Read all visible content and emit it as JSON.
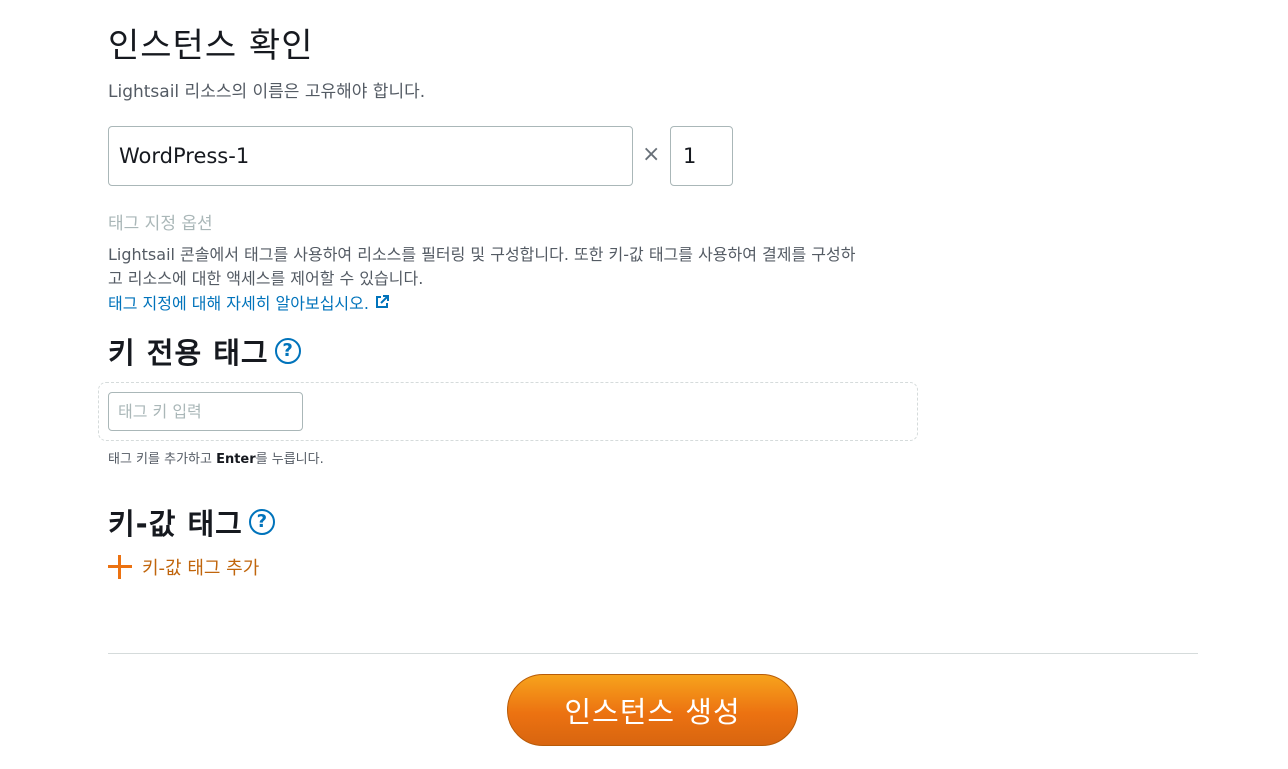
{
  "confirm": {
    "title": "인스턴스 확인",
    "description": "Lightsail 리소스의 이름은 고유해야 합니다.",
    "name_value": "WordPress-1",
    "times_symbol": "×",
    "count_value": "1"
  },
  "tagging": {
    "options_label": "태그 지정 옵션",
    "description": "Lightsail 콘솔에서 태그를 사용하여 리소스를 필터링 및 구성합니다. 또한 키-값 태그를 사용하여 결제를 구성하고 리소스에 대한 액세스를 제어할 수 있습니다.",
    "learn_more_link": "태그 지정에 대해 자세히 알아보십시오.",
    "link_icon": "external-link-icon"
  },
  "key_only": {
    "title": "키 전용 태그",
    "help_icon": "question-mark",
    "input_placeholder": "태그 키 입력",
    "hint_prefix": "태그 키를 추가하고 ",
    "hint_key": "Enter",
    "hint_suffix": "를 누릅니다."
  },
  "key_value": {
    "title": "키-값 태그",
    "help_icon": "question-mark",
    "add_label": "키-값 태그 추가",
    "add_icon": "plus-icon"
  },
  "footer": {
    "create_button": "인스턴스 생성"
  },
  "colors": {
    "link": "#0073bb",
    "accent_orange": "#ec7211",
    "text_dark": "#16191f",
    "text_muted": "#545b64"
  }
}
